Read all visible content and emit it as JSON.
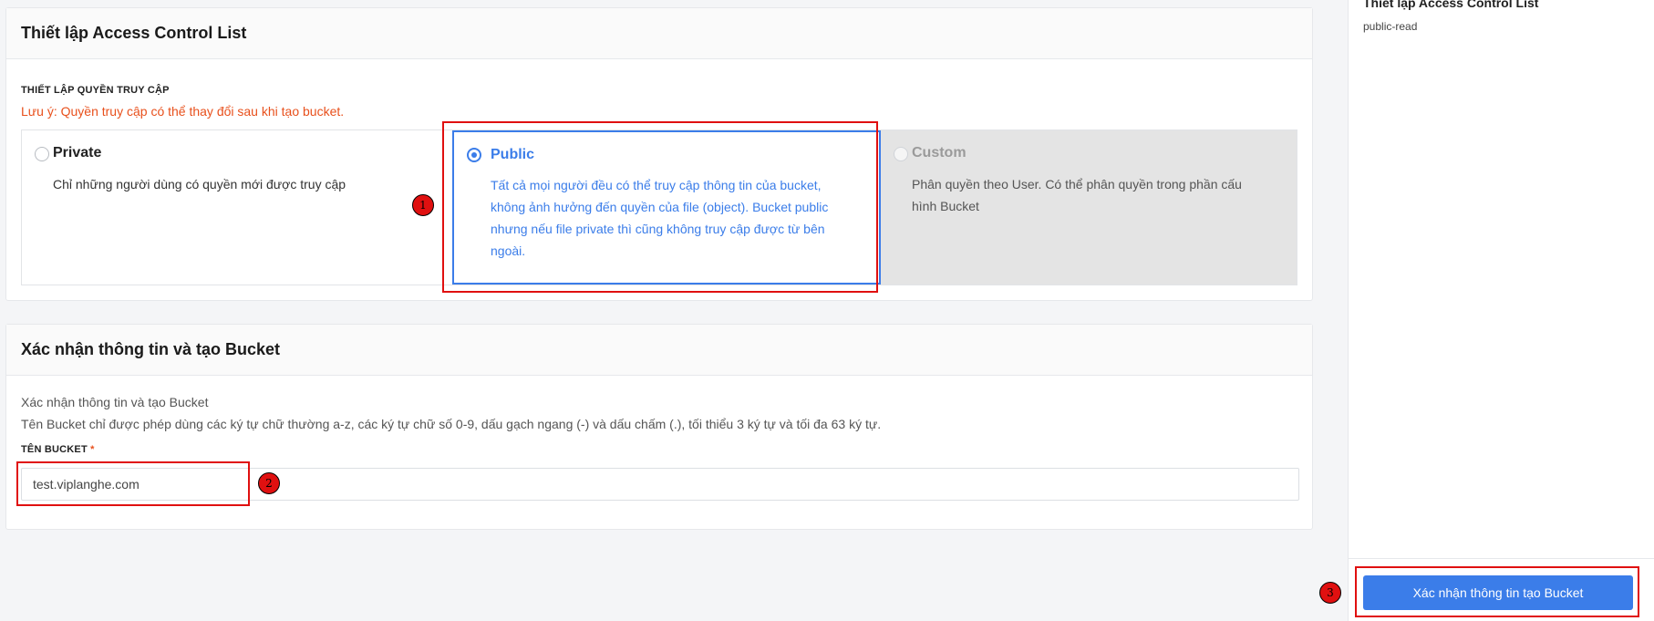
{
  "acl_panel": {
    "title": "Thiết lập Access Control List",
    "subheading": "THIẾT LẬP QUYỀN TRUY CẬP",
    "warning": "Lưu ý: Quyền truy cập có thể thay đổi sau khi tạo bucket.",
    "options": [
      {
        "title": "Private",
        "description": "Chỉ những người dùng có quyền mới được truy cập",
        "selected": false,
        "disabled": false
      },
      {
        "title": "Public",
        "description": "Tất cả mọi người đều có thể truy cập thông tin của bucket, không ảnh hưởng đến quyền của file (object). Bucket public nhưng nếu file private thì cũng không truy cập được từ bên ngoài.",
        "selected": true,
        "disabled": false
      },
      {
        "title": "Custom",
        "description": "Phân quyền theo User. Có thể phân quyền trong phần cấu hình Bucket",
        "selected": false,
        "disabled": true
      }
    ]
  },
  "confirm_panel": {
    "title": "Xác nhận thông tin và tạo Bucket",
    "line1": "Xác nhận thông tin và tạo Bucket",
    "line2": "Tên Bucket chỉ được phép dùng các ký tự chữ thường a-z, các ký tự chữ số 0-9, dấu gạch ngang (-) và dấu chấm (.), tối thiểu 3 ký tự và tối đa 63 ký tự.",
    "field_label": "TÊN BUCKET",
    "required_mark": "*",
    "bucket_name_value": "test.viplanghe.com"
  },
  "sidebar": {
    "acl_title": "Thiết lập Access Control List",
    "acl_value": "public-read",
    "submit_label": "Xác nhận thông tin tạo Bucket"
  },
  "annotations": [
    "1",
    "2",
    "3"
  ],
  "colors": {
    "accent": "#3b7de9",
    "warning": "#e8501c",
    "annotation": "#e01010"
  }
}
